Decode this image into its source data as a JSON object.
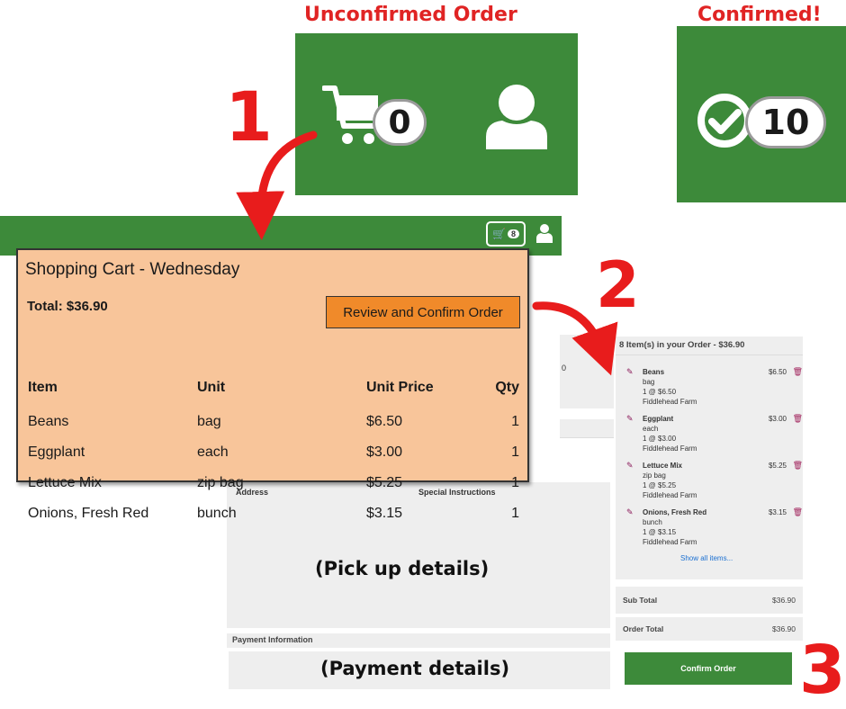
{
  "labels": {
    "unconfirmed": "Unconfirmed Order",
    "confirmed": "Confirmed!"
  },
  "icons": {
    "cart": "shopping-cart-icon",
    "user": "user-icon",
    "check": "check-circle-icon"
  },
  "badges": {
    "unconfirmed_count": "0",
    "confirmed_count": "10",
    "nav_cart_count": "8"
  },
  "steps": {
    "one": "1",
    "two": "2",
    "three": "3"
  },
  "cart": {
    "title": "Shopping Cart - Wednesday",
    "total": "Total: $36.90",
    "review_button": "Review and Confirm Order",
    "headers": {
      "item": "Item",
      "unit": "Unit",
      "price": "Unit Price",
      "qty": "Qty"
    },
    "rows": [
      {
        "item": "Beans",
        "unit": "bag",
        "price": "$6.50",
        "qty": "1"
      },
      {
        "item": "Eggplant",
        "unit": "each",
        "price": "$3.00",
        "qty": "1"
      },
      {
        "item": "Lettuce Mix",
        "unit": "zip bag",
        "price": "$5.25",
        "qty": "1"
      },
      {
        "item": "Onions, Fresh Red",
        "unit": "bunch",
        "price": "$3.15",
        "qty": "1"
      }
    ]
  },
  "checkout": {
    "fragment_text": "0",
    "address_label": "Address",
    "special_label": "Special Instructions",
    "pickup_placeholder": "(Pick up details)",
    "payment_label": "Payment Information",
    "payment_placeholder": "(Payment details)"
  },
  "order_summary": {
    "header": "8 Item(s) in your Order - $36.90",
    "items": [
      {
        "name": "Beans",
        "unit": "bag",
        "qty_line": "1 @ $6.50",
        "farm": "Fiddlehead Farm",
        "price": "$6.50"
      },
      {
        "name": "Eggplant",
        "unit": "each",
        "qty_line": "1 @ $3.00",
        "farm": "Fiddlehead Farm",
        "price": "$3.00"
      },
      {
        "name": "Lettuce Mix",
        "unit": "zip bag",
        "qty_line": "1 @ $5.25",
        "farm": "Fiddlehead Farm",
        "price": "$5.25"
      },
      {
        "name": "Onions, Fresh Red",
        "unit": "bunch",
        "qty_line": "1 @ $3.15",
        "farm": "Fiddlehead Farm",
        "price": "$3.15"
      }
    ],
    "show_all": "Show all items...",
    "subtotal_label": "Sub Total",
    "subtotal_value": "$36.90",
    "order_total_label": "Order Total",
    "order_total_value": "$36.90",
    "confirm_button": "Confirm Order"
  },
  "colors": {
    "brand_green": "#3d8a3a",
    "cart_panel": "#f8c59a",
    "review_button": "#f08a2a",
    "callout_red": "#e81c1c"
  }
}
